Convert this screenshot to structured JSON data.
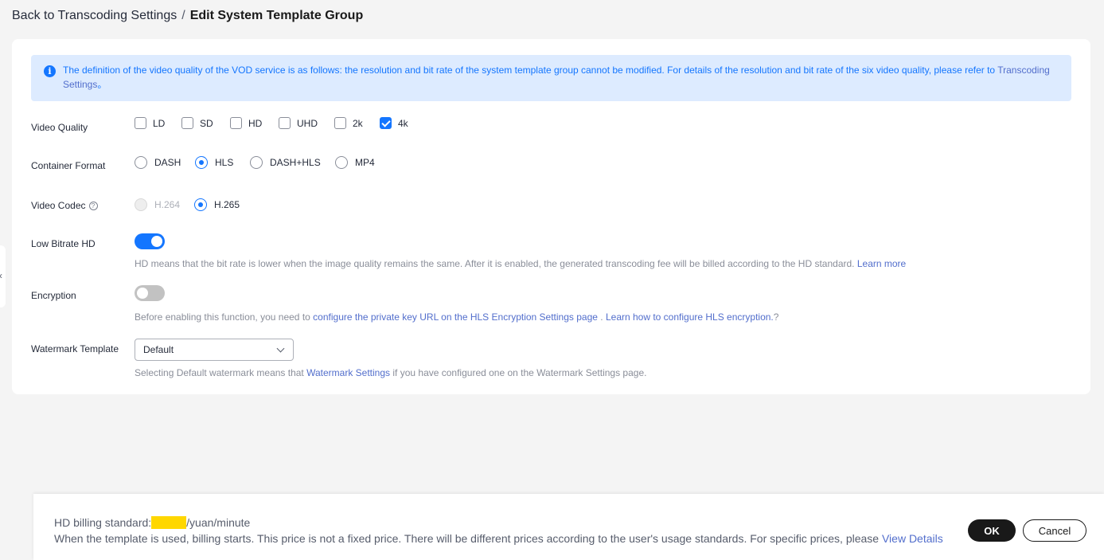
{
  "breadcrumb": {
    "back": "Back to Transcoding Settings",
    "separator": "/",
    "current": "Edit System Template Group"
  },
  "notice": {
    "text": "The definition of the video quality of the VOD service is as follows: the resolution and bit rate of the system template group cannot be modified. For details of the resolution and bit rate of the six video quality, please refer to ",
    "link": "Transcoding Settings",
    "suffix": "。",
    "icon": "info-icon",
    "color": "#1476ff"
  },
  "video_quality": {
    "label": "Video Quality",
    "options": [
      {
        "label": "LD",
        "checked": false
      },
      {
        "label": "SD",
        "checked": false
      },
      {
        "label": "HD",
        "checked": false
      },
      {
        "label": "UHD",
        "checked": false
      },
      {
        "label": "2k",
        "checked": false
      },
      {
        "label": "4k",
        "checked": true
      }
    ]
  },
  "container_format": {
    "label": "Container Format",
    "options": [
      {
        "label": "DASH",
        "selected": false
      },
      {
        "label": "HLS",
        "selected": true
      },
      {
        "label": "DASH+HLS",
        "selected": false
      },
      {
        "label": "MP4",
        "selected": false
      }
    ]
  },
  "video_codec": {
    "label": "Video Codec",
    "help_icon": "?",
    "options": [
      {
        "label": "H.264",
        "selected": false,
        "disabled": true
      },
      {
        "label": "H.265",
        "selected": true,
        "disabled": false
      }
    ]
  },
  "low_bitrate_hd": {
    "label": "Low Bitrate HD",
    "enabled": true,
    "hint": "HD means that the bit rate is lower when the image quality remains the same. After it is enabled, the generated transcoding fee will be billed according to the HD standard.",
    "link": "Learn more"
  },
  "encryption": {
    "label": "Encryption",
    "enabled": false,
    "hint_prefix": "Before enabling this function, you need to",
    "link1": "configure the private key URL on the HLS Encryption Settings page",
    "middle": ".",
    "link2": "Learn how to configure HLS encryption.",
    "suffix": "?"
  },
  "watermark": {
    "label": "Watermark Template",
    "selected": "Default",
    "hint_prefix": "Selecting Default watermark means that",
    "link": "Watermark Settings",
    "hint_suffix": "if you have configured one on the Watermark Settings page."
  },
  "side_tab": {
    "glyph": "‹"
  },
  "footer": {
    "billing_prefix": "HD billing standard:",
    "billing_suffix": "/yuan/minute",
    "note": "When the template is used, billing starts. This price is not a fixed price. There will be different prices according to the user's usage standards. For specific prices, please",
    "link": "View Details",
    "ok": "OK",
    "cancel": "Cancel",
    "mask_color": "#ffd700"
  }
}
